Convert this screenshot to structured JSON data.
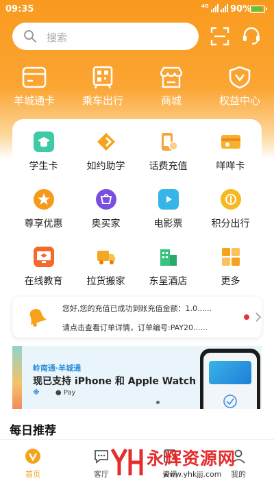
{
  "status": {
    "time": "09:35",
    "network": "4G",
    "battery": "90%"
  },
  "search": {
    "placeholder": "搜索"
  },
  "top_entries": [
    {
      "label": "羊城通卡",
      "icon": "card-icon"
    },
    {
      "label": "乘车出行",
      "icon": "transit-icon"
    },
    {
      "label": "商城",
      "icon": "shop-icon"
    },
    {
      "label": "权益中心",
      "icon": "shield-icon"
    }
  ],
  "grid": [
    {
      "label": "学生卡",
      "icon": "student-card-icon",
      "color": "#3ec9a7"
    },
    {
      "label": "如约助学",
      "icon": "study-aid-icon",
      "color": "#f7a21b"
    },
    {
      "label": "话费充值",
      "icon": "phone-recharge-icon",
      "color": "#f6a43b"
    },
    {
      "label": "咩咩卡",
      "icon": "mie-card-icon",
      "color": "#f7b12c"
    },
    {
      "label": "尊享优惠",
      "icon": "vip-discount-icon",
      "color": "#f59a1a"
    },
    {
      "label": "奥买家",
      "icon": "shopping-icon",
      "color": "#7a4fe0"
    },
    {
      "label": "电影票",
      "icon": "movie-ticket-icon",
      "color": "#36b6e8"
    },
    {
      "label": "积分出行",
      "icon": "points-travel-icon",
      "color": "#f7b824"
    },
    {
      "label": "在线教育",
      "icon": "online-education-icon",
      "color": "#f46a2a"
    },
    {
      "label": "拉货搬家",
      "icon": "moving-truck-icon",
      "color": "#f5a623"
    },
    {
      "label": "东呈酒店",
      "icon": "hotel-icon",
      "color": "#38c47e"
    },
    {
      "label": "更多",
      "icon": "more-icon",
      "color": "#f7a21b"
    }
  ],
  "notice": {
    "line1": "您好,您的充值已成功到账充值金额：1.0......",
    "line2": "请点击查看订单详情，订单编号:PAY20......"
  },
  "banner": {
    "subtitle": "岭南通·羊城通",
    "title": "现已支持 iPhone 和 Apple Watch",
    "logo_text": "Pay"
  },
  "section": {
    "daily_title": "每日推荐"
  },
  "tabbar": [
    {
      "label": "首页",
      "active": true
    },
    {
      "label": "客厅",
      "active": false
    },
    {
      "label": "资讯",
      "active": false
    },
    {
      "label": "我的",
      "active": false
    }
  ],
  "watermark": {
    "text": "永辉资源网",
    "url": "www.yhkjjj.com"
  },
  "colors": {
    "brand_orange": "#f99a1e",
    "accent_red": "#e8343a"
  }
}
